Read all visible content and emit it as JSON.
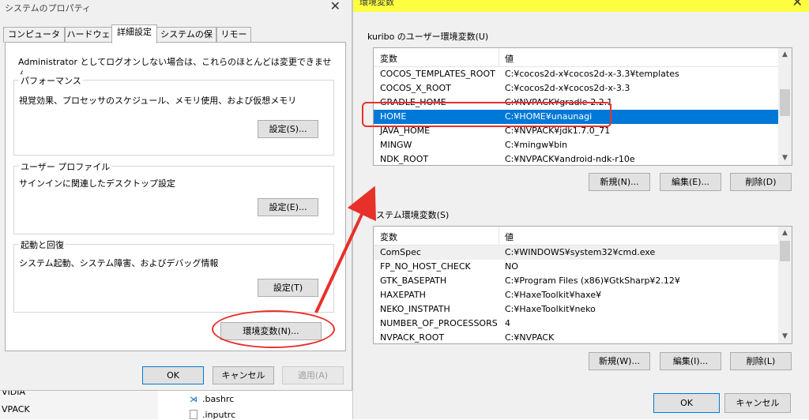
{
  "background": {
    "left_items": [
      "VIDIA",
      "VPACK"
    ],
    "files": [
      {
        "name": ".bashrc",
        "icon": "vscode-icon"
      },
      {
        "name": ".inputrc",
        "icon": "file-icon"
      }
    ]
  },
  "sysprops": {
    "title": "システムのプロパティ",
    "close": "✕",
    "tabs": [
      "コンピューター名",
      "ハードウェア",
      "詳細設定",
      "システムの保護",
      "リモート"
    ],
    "active_tab": "詳細設定",
    "admin_note": "Administrator としてログオンしない場合は、これらのほとんどは変更できません。",
    "performance": {
      "legend": "パフォーマンス",
      "desc": "視覚効果、プロセッサのスケジュール、メモリ使用、および仮想メモリ",
      "button": "設定(S)..."
    },
    "profile": {
      "legend": "ユーザー プロファイル",
      "desc": "サインインに関連したデスクトップ設定",
      "button": "設定(E)..."
    },
    "startup": {
      "legend": "起動と回復",
      "desc": "システム起動、システム障害、およびデバッグ情報",
      "button": "設定(T)"
    },
    "env_button": "環境変数(N)...",
    "ok": "OK",
    "cancel": "キャンセル",
    "apply": "適用(A)"
  },
  "envvars": {
    "title": "環境変数",
    "close": "✕",
    "user_section": "kuribo のユーザー環境変数(U)",
    "col_var": "変数",
    "col_val": "値",
    "user_rows": [
      {
        "name": "COCOS_TEMPLATES_ROOT",
        "value": "C:¥cocos2d-x¥cocos2d-x-3.3¥templates"
      },
      {
        "name": "COCOS_X_ROOT",
        "value": "C:¥cocos2d-x¥cocos2d-x-3.3"
      },
      {
        "name": "GRADLE_HOME",
        "value": "C:¥NVPACK¥gradle-2.2.1"
      },
      {
        "name": "HOME",
        "value": "C:¥HOME¥unaunagi"
      },
      {
        "name": "JAVA_HOME",
        "value": "C:¥NVPACK¥jdk1.7.0_71"
      },
      {
        "name": "MINGW",
        "value": "C:¥mingw¥bin"
      },
      {
        "name": "NDK_ROOT",
        "value": "C:¥NVPACK¥android-ndk-r10e"
      }
    ],
    "user_buttons": {
      "new": "新規(N)...",
      "edit": "編集(E)...",
      "delete": "削除(D)"
    },
    "system_section": "システム環境変数(S)",
    "system_rows": [
      {
        "name": "ComSpec",
        "value": "C:¥WINDOWS¥system32¥cmd.exe"
      },
      {
        "name": "FP_NO_HOST_CHECK",
        "value": "NO"
      },
      {
        "name": "GTK_BASEPATH",
        "value": "C:¥Program Files (x86)¥GtkSharp¥2.12¥"
      },
      {
        "name": "HAXEPATH",
        "value": "C:¥HaxeToolkit¥haxe¥"
      },
      {
        "name": "NEKO_INSTPATH",
        "value": "C:¥HaxeToolkit¥neko"
      },
      {
        "name": "NUMBER_OF_PROCESSORS",
        "value": "4"
      },
      {
        "name": "NVPACK_ROOT",
        "value": "C:¥NVPACK"
      }
    ],
    "system_buttons": {
      "new": "新規(W)...",
      "edit": "編集(I)...",
      "delete": "削除(L)"
    },
    "ok": "OK",
    "cancel": "キャンセル"
  },
  "colors": {
    "selection": "#0078d7",
    "annotation": "#e8302a",
    "titlebar_highlight": "#fefe40"
  }
}
